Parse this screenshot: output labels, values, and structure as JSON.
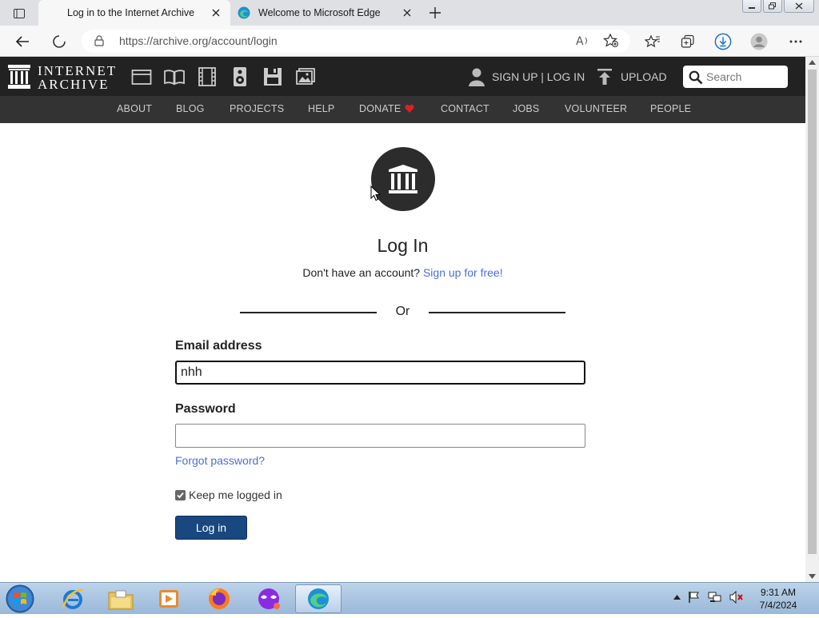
{
  "browser": {
    "tabs": [
      {
        "title": "Log in to the Internet Archive",
        "active": true
      },
      {
        "title": "Welcome to Microsoft Edge",
        "active": false
      }
    ],
    "url": "https://archive.org/account/login"
  },
  "ia": {
    "logo_line1": "INTERNET",
    "logo_line2": "ARCHIVE",
    "signup_login": "SIGN UP | LOG IN",
    "upload": "UPLOAD",
    "search_placeholder": "Search",
    "nav": [
      "ABOUT",
      "BLOG",
      "PROJECTS",
      "HELP",
      "DONATE",
      "CONTACT",
      "JOBS",
      "VOLUNTEER",
      "PEOPLE"
    ]
  },
  "login": {
    "title": "Log In",
    "no_account": "Don't have an account?",
    "signup_link": "Sign up for free!",
    "or": "Or",
    "email_label": "Email address",
    "email_value": "nhh",
    "password_label": "Password",
    "password_value": "",
    "forgot": "Forgot password?",
    "keep_logged_in": "Keep me logged in",
    "keep_checked": true,
    "button": "Log in"
  },
  "taskbar": {
    "time": "9:31 AM",
    "date": "7/4/2024"
  },
  "colors": {
    "ia_header": "#222222",
    "ia_nav": "#333333",
    "link": "#4a6fd6",
    "login_button": "#194880",
    "donate_heart": "#e02020"
  }
}
